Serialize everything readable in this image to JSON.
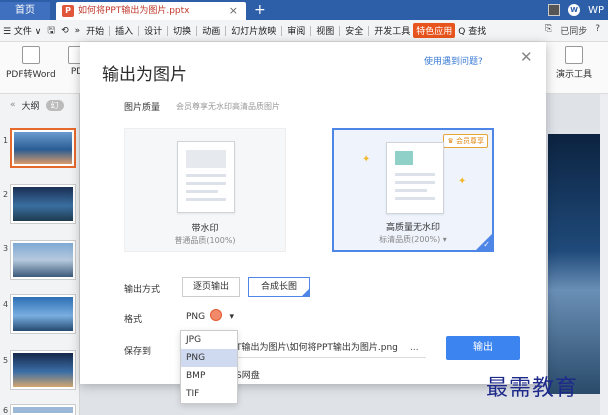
{
  "titlebar": {
    "home_tab": "首页",
    "doc_badge": "P",
    "doc_tab": "如何将PPT输出为图片.pptx",
    "close_glyph": "×",
    "new_tab_glyph": "+",
    "wps_label": "WP"
  },
  "menubar": {
    "file": "☰ 文件 ∨",
    "items": [
      "开始",
      "插入",
      "设计",
      "切换",
      "动画",
      "幻灯片放映",
      "审阅",
      "视图",
      "安全",
      "开发工具"
    ],
    "special": "特色应用",
    "search": "Q 查找",
    "right": [
      "已同步",
      "?"
    ]
  },
  "ribbon": {
    "left_label": "PDF转Word",
    "left2_label": "PD",
    "right_label": "演示工具"
  },
  "sidebar": {
    "outline_label": "大纲",
    "slides_pill": "幻",
    "slide_numbers": [
      "1",
      "2",
      "3",
      "4",
      "5",
      "6"
    ]
  },
  "dialog": {
    "title": "输出为图片",
    "help_link": "使用遇到问题?",
    "quality_label": "图片质量",
    "quality_hint": "会员尊享无水印高清品质图片",
    "card_watermark": {
      "caption": "带水印",
      "sub": "普通品质(100%)"
    },
    "card_hq": {
      "caption": "高质量无水印",
      "sub": "标清品质(200%) ▾",
      "badge": "♛ 会员尊享"
    },
    "output_mode_label": "输出方式",
    "btn_per_page": "逐页输出",
    "btn_long": "合成长图",
    "format_label": "格式",
    "format_value": "PNG",
    "format_options": [
      "JPG",
      "PNG",
      "BMP",
      "TIF"
    ],
    "save_to_label": "保存到",
    "save_path": "T输出为图片\\如何将PPT输出为图片.png",
    "path_more": "...",
    "export_btn": "输出",
    "cloud_label": "S网盘"
  },
  "watermark_text": "最需教育"
}
